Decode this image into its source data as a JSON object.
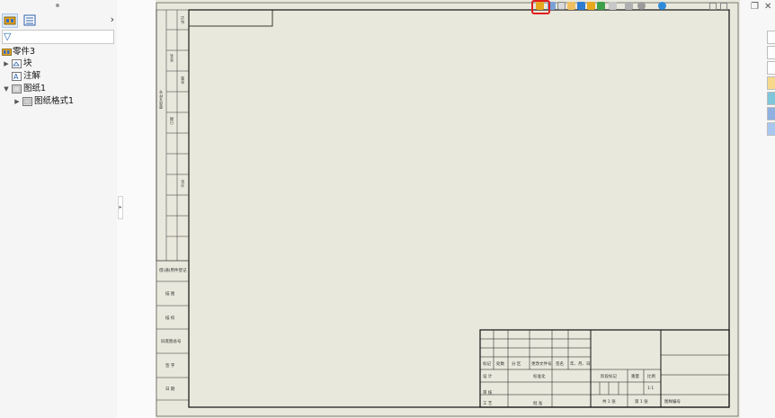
{
  "tree": {
    "items": [
      {
        "label": "零件3"
      },
      {
        "label": "块"
      },
      {
        "label": "注解"
      },
      {
        "label": "图纸1"
      },
      {
        "label": "图纸格式1"
      }
    ]
  },
  "drawing": {
    "left_strip_labels": [
      "更改文件号",
      "签名",
      "日期",
      "标记",
      "处数",
      "分区"
    ],
    "left_column_labels": [
      "借(通)用件登记",
      "描 图",
      "描 校",
      "旧底图总号",
      "签 字",
      "日 期"
    ],
    "title_block": {
      "row_labels": [
        "标记",
        "处数",
        "分 区",
        "更改文件号",
        "签名",
        "年、月、日"
      ],
      "left_labels": [
        "设 计",
        "审 核",
        "工 艺"
      ],
      "mid_labels": [
        "标准化",
        "批 准"
      ],
      "stage_label": "阶段标记",
      "weight_label": "重量",
      "scale_label": "比例",
      "scale_value": "1:1",
      "sheet_count": "共 1 张",
      "sheet_no": "第 1 张",
      "code_label": "图样编号"
    }
  },
  "colors": {
    "sheet": "#e9e8dc",
    "highlight": "#e11d1d",
    "accent": "#1e63b4"
  }
}
